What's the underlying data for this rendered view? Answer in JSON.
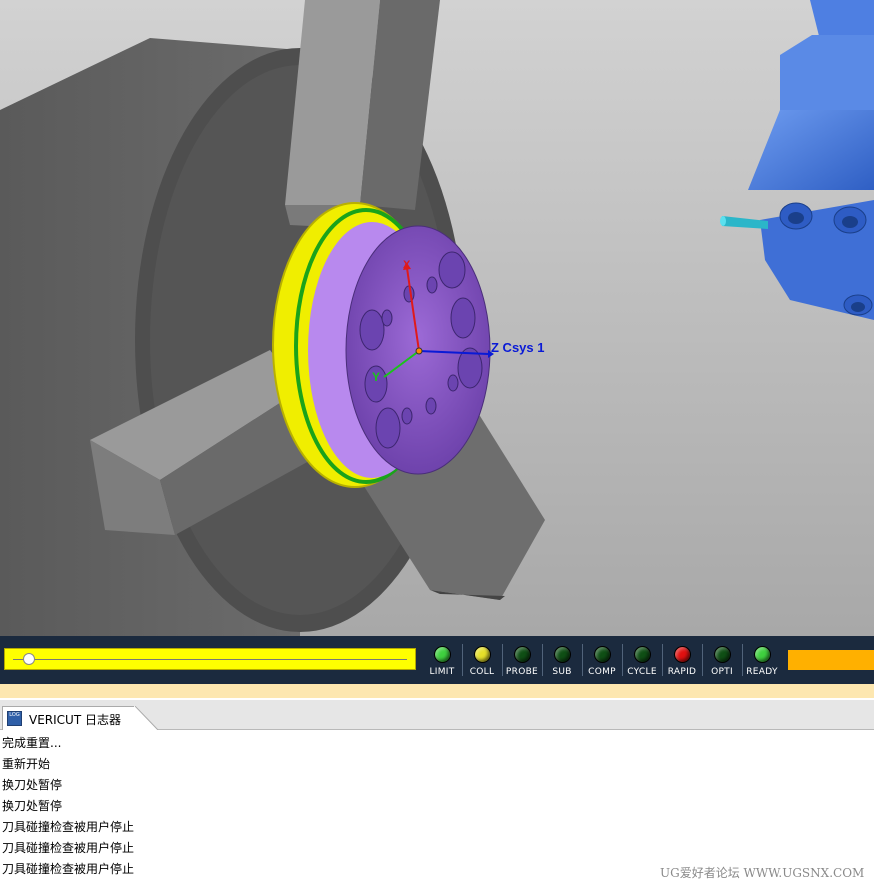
{
  "viewport": {
    "csys_label": "Z Csys 1",
    "axis_x_label": "X",
    "axis_y_label": "Y",
    "colors": {
      "background_top": "#cfcfcf",
      "background_bottom": "#a9a9a9",
      "workpiece": "#8a5ec7",
      "jaw": "#6e6e6e",
      "chuck": "#555555",
      "tool_holder": "#4a7de0"
    }
  },
  "status": {
    "progress": 0.02,
    "lights": [
      {
        "label": "LIMIT",
        "color": "#3fd03f"
      },
      {
        "label": "COLL",
        "color": "#e6e02a"
      },
      {
        "label": "PROBE",
        "color": "#0f4f15"
      },
      {
        "label": "SUB",
        "color": "#0f4f15"
      },
      {
        "label": "COMP",
        "color": "#0f4f15"
      },
      {
        "label": "CYCLE",
        "color": "#0f4f15"
      },
      {
        "label": "RAPID",
        "color": "#e01010"
      },
      {
        "label": "OPTI",
        "color": "#0f4f15"
      },
      {
        "label": "READY",
        "color": "#3fd03f"
      }
    ]
  },
  "logger": {
    "tab_icon_text": "LOG",
    "tab_label": "VERICUT 日志器",
    "lines": [
      "完成重置...",
      "重新开始",
      "换刀处暂停",
      "换刀处暂停",
      "刀具碰撞检查被用户停止",
      "刀具碰撞检查被用户停止",
      "刀具碰撞检查被用户停止"
    ]
  },
  "watermark": "UG爱好者论坛 WWW.UGSNX.COM"
}
